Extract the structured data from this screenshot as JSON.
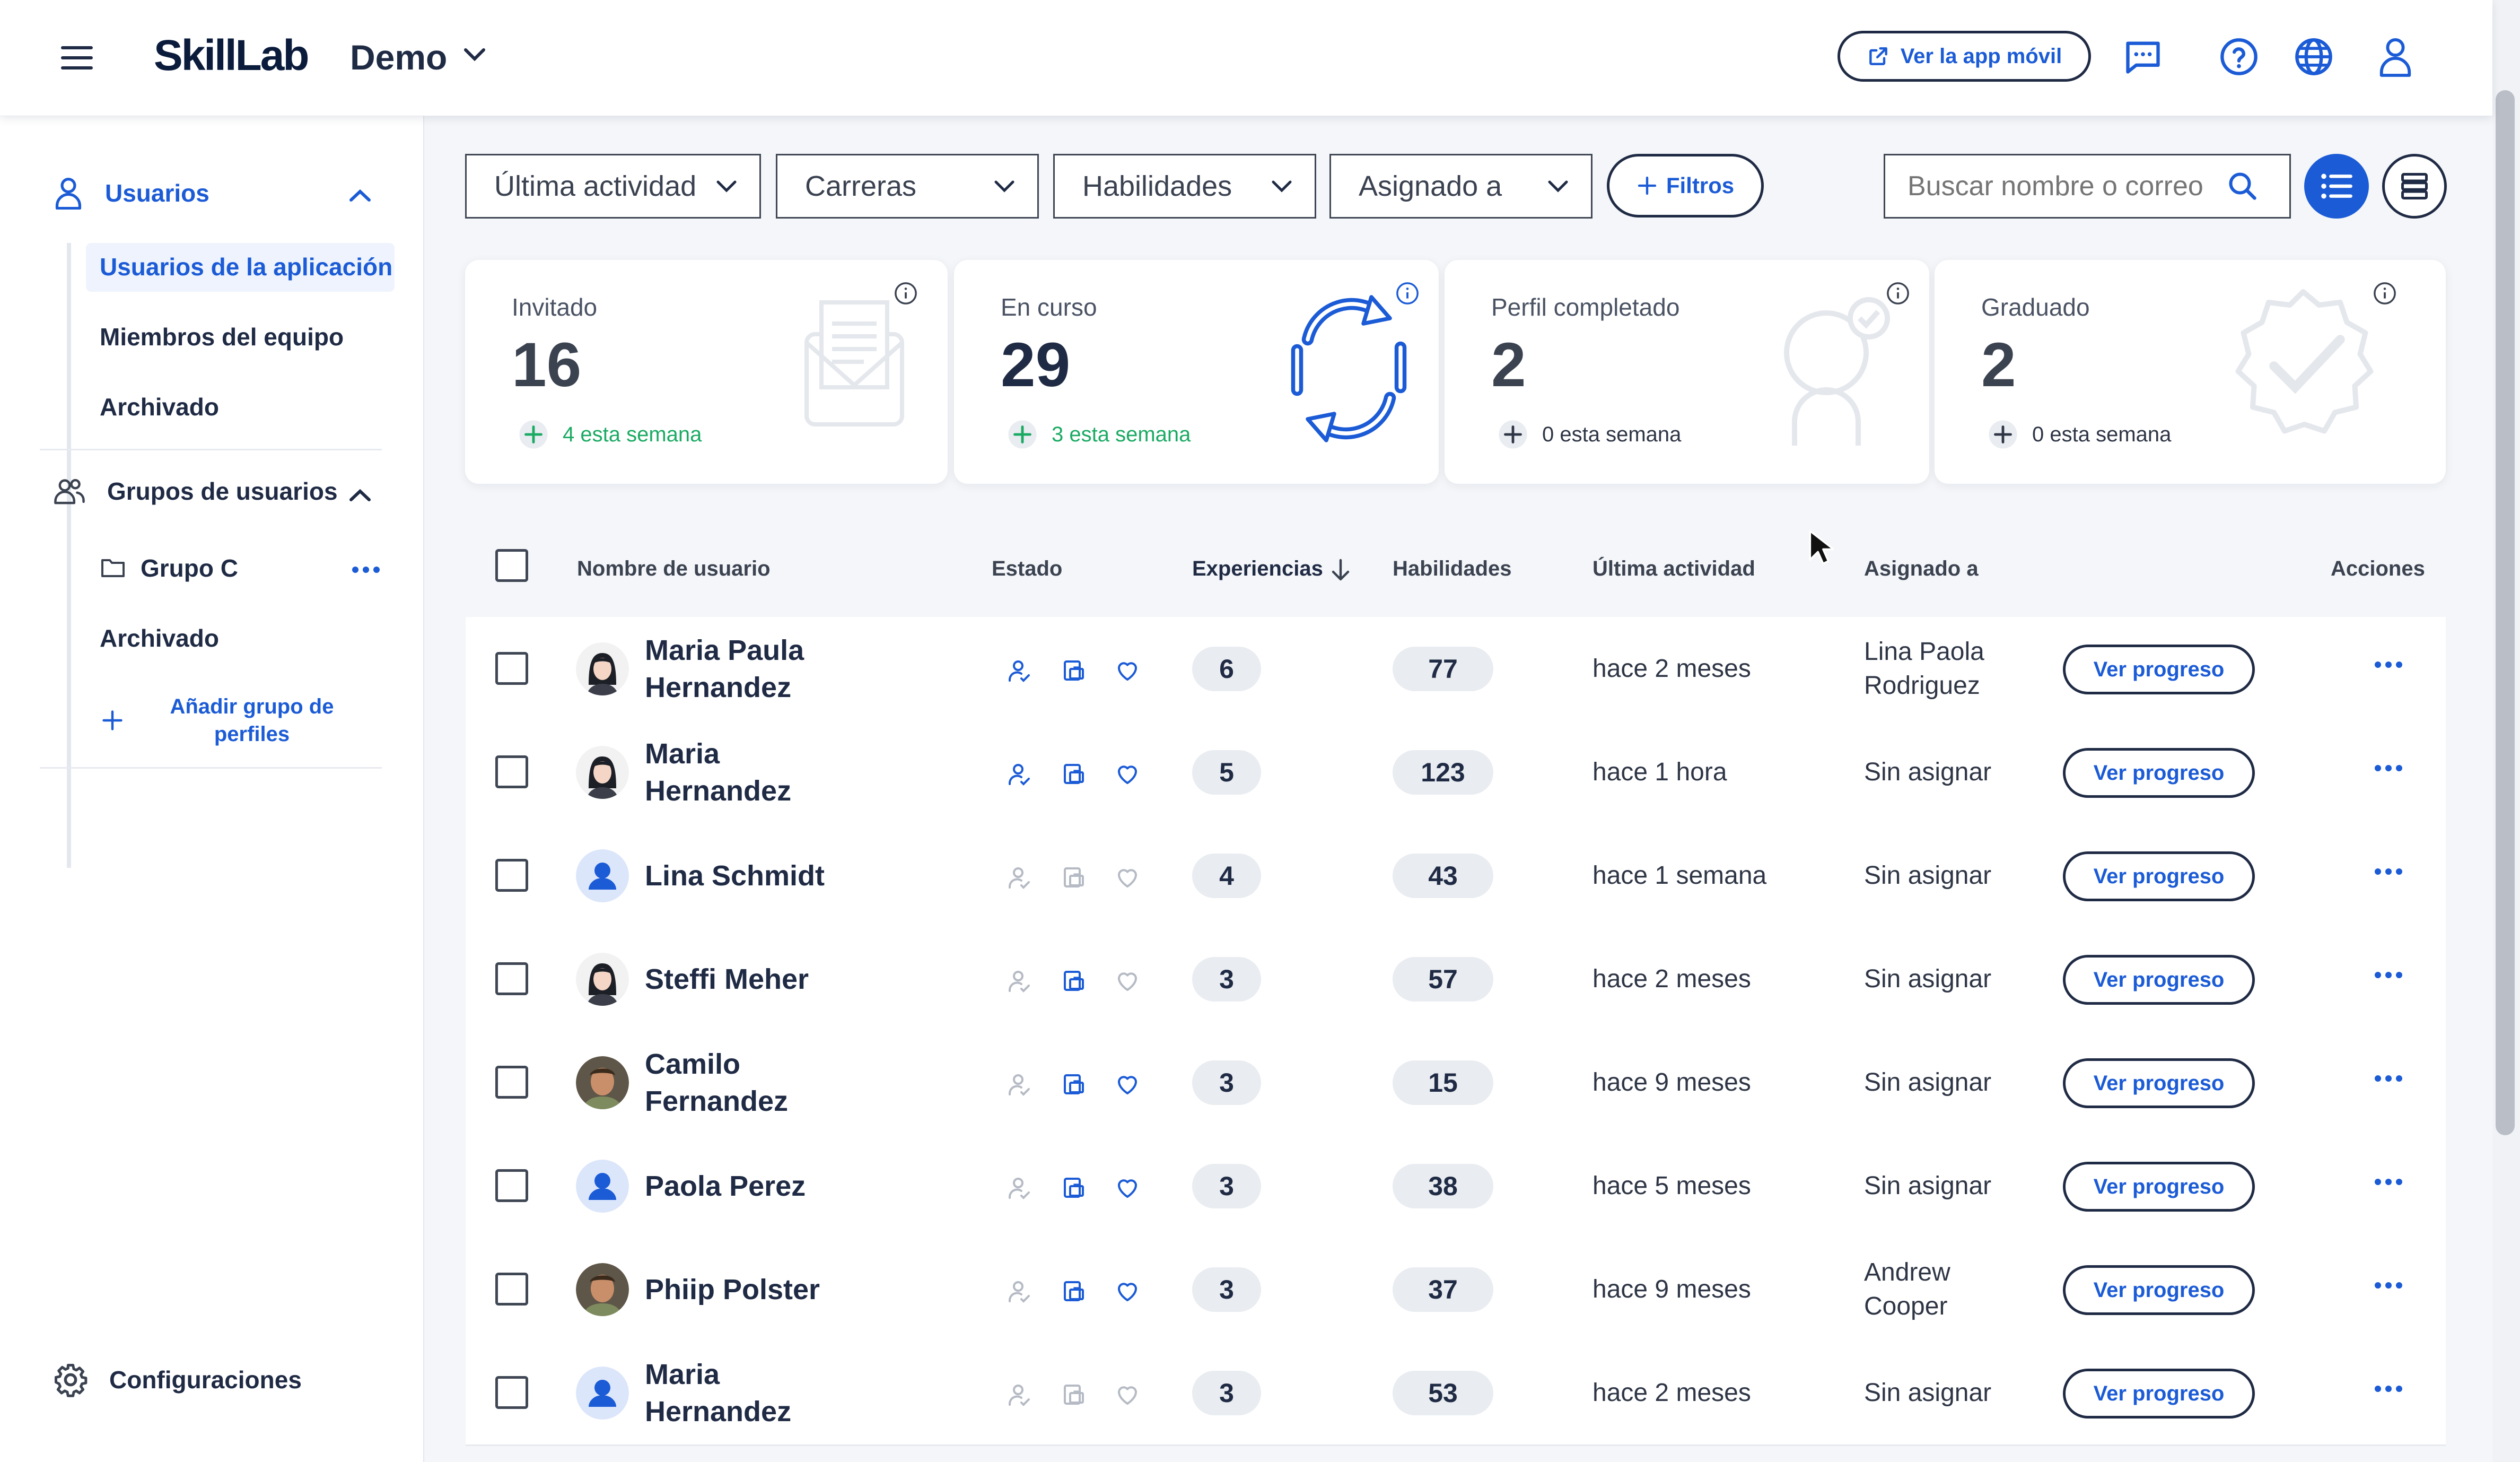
{
  "header": {
    "logo": "SkillLab",
    "org_name": "Demo",
    "mobile_app_label": "Ver la app móvil"
  },
  "sidebar": {
    "users_section": "Usuarios",
    "users_items": [
      {
        "label": "Usuarios de la aplicación",
        "active": true
      },
      {
        "label": "Miembros del equipo"
      },
      {
        "label": "Archivado"
      }
    ],
    "groups_section": "Grupos de usuarios",
    "groups_items": [
      {
        "label": "Grupo C"
      },
      {
        "label": "Archivado"
      }
    ],
    "add_group_label": "Añadir grupo de perfiles",
    "settings_label": "Configuraciones"
  },
  "filters": {
    "dropdowns": [
      "Última actividad",
      "Carreras",
      "Habilidades",
      "Asignado a"
    ],
    "filters_button": "Filtros",
    "search_placeholder": "Buscar nombre o correo"
  },
  "stats": [
    {
      "label": "Invitado",
      "value": "16",
      "week": "4 esta semana",
      "week_color": "#1AAA63"
    },
    {
      "label": "En curso",
      "value": "29",
      "week": "3 esta semana",
      "week_color": "#1AAA63"
    },
    {
      "label": "Perfil completado",
      "value": "2",
      "week": "0 esta semana",
      "week_color": "#2E3545"
    },
    {
      "label": "Graduado",
      "value": "2",
      "week": "0 esta semana",
      "week_color": "#2E3545"
    }
  ],
  "table": {
    "headers": {
      "name": "Nombre de usuario",
      "status": "Estado",
      "experiences": "Experiencias",
      "skills": "Habilidades",
      "last_activity": "Última actividad",
      "assigned": "Asignado a",
      "actions": "Acciones"
    },
    "progress_label": "Ver progreso",
    "rows": [
      {
        "name": "Maria Paula Hernandez",
        "avatar": "female-illustration",
        "status": [
          true,
          true,
          true
        ],
        "experiences": "6",
        "skills": "77",
        "last_activity": "hace 2 meses",
        "assigned": "Lina Paola Rodriguez"
      },
      {
        "name": "Maria Hernandez",
        "avatar": "female-illustration",
        "status": [
          true,
          true,
          true
        ],
        "experiences": "5",
        "skills": "123",
        "last_activity": "hace 1 hora",
        "assigned": "Sin asignar"
      },
      {
        "name": "Lina Schmidt",
        "avatar": "default-user",
        "status": [
          false,
          false,
          false
        ],
        "experiences": "4",
        "skills": "43",
        "last_activity": "hace 1 semana",
        "assigned": "Sin asignar"
      },
      {
        "name": "Steffi Meher",
        "avatar": "female-illustration",
        "status": [
          false,
          true,
          false
        ],
        "experiences": "3",
        "skills": "57",
        "last_activity": "hace 2 meses",
        "assigned": "Sin asignar"
      },
      {
        "name": "Camilo Fernandez",
        "avatar": "photo",
        "status": [
          false,
          true,
          true
        ],
        "experiences": "3",
        "skills": "15",
        "last_activity": "hace 9 meses",
        "assigned": "Sin asignar"
      },
      {
        "name": "Paola Perez",
        "avatar": "default-user",
        "status": [
          false,
          true,
          true
        ],
        "experiences": "3",
        "skills": "38",
        "last_activity": "hace 5 meses",
        "assigned": "Sin asignar"
      },
      {
        "name": "Phiip Polster",
        "avatar": "photo",
        "status": [
          false,
          true,
          true
        ],
        "experiences": "3",
        "skills": "37",
        "last_activity": "hace 9 meses",
        "assigned": "Andrew Cooper"
      },
      {
        "name": "Maria Hernandez",
        "avatar": "default-user",
        "status": [
          false,
          false,
          false
        ],
        "experiences": "3",
        "skills": "53",
        "last_activity": "hace 2 meses",
        "assigned": "Sin asignar"
      }
    ]
  },
  "colors": {
    "primary": "#1B5BD6",
    "dark": "#1F2A44",
    "success": "#1AAA63",
    "icon_inactive": "#B5BAC4"
  }
}
